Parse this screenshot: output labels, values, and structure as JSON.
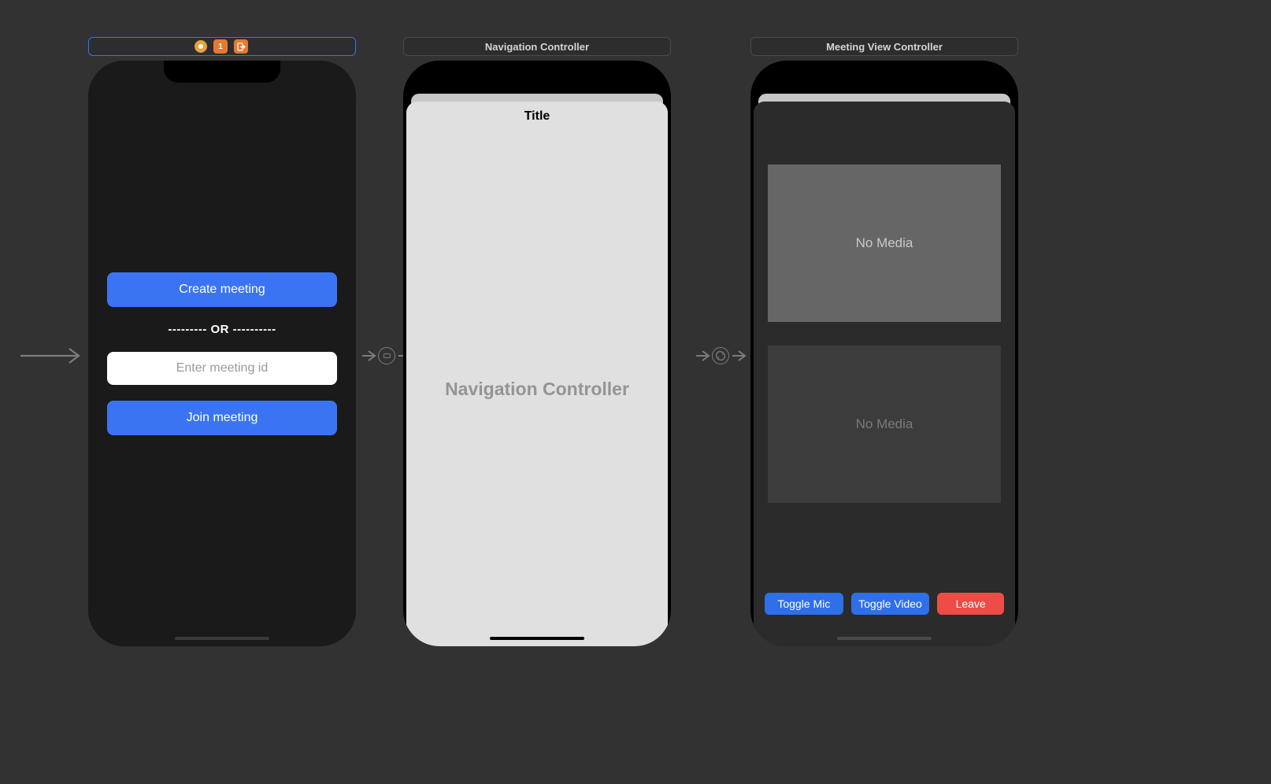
{
  "scenes": {
    "start": {
      "create_btn": "Create meeting",
      "or_label": "---------  OR  ----------",
      "meeting_id_placeholder": "Enter meeting id",
      "join_btn": "Join meeting"
    },
    "nav": {
      "header": "Navigation Controller",
      "title": "Title",
      "placeholder": "Navigation Controller"
    },
    "meeting": {
      "header": "Meeting View Controller",
      "tile1": "No Media",
      "tile2": "No Media",
      "toggle_mic": "Toggle Mic",
      "toggle_video": "Toggle Video",
      "leave": "Leave"
    }
  },
  "header_icons": {
    "badge1": "1",
    "badge2": "⎘"
  }
}
